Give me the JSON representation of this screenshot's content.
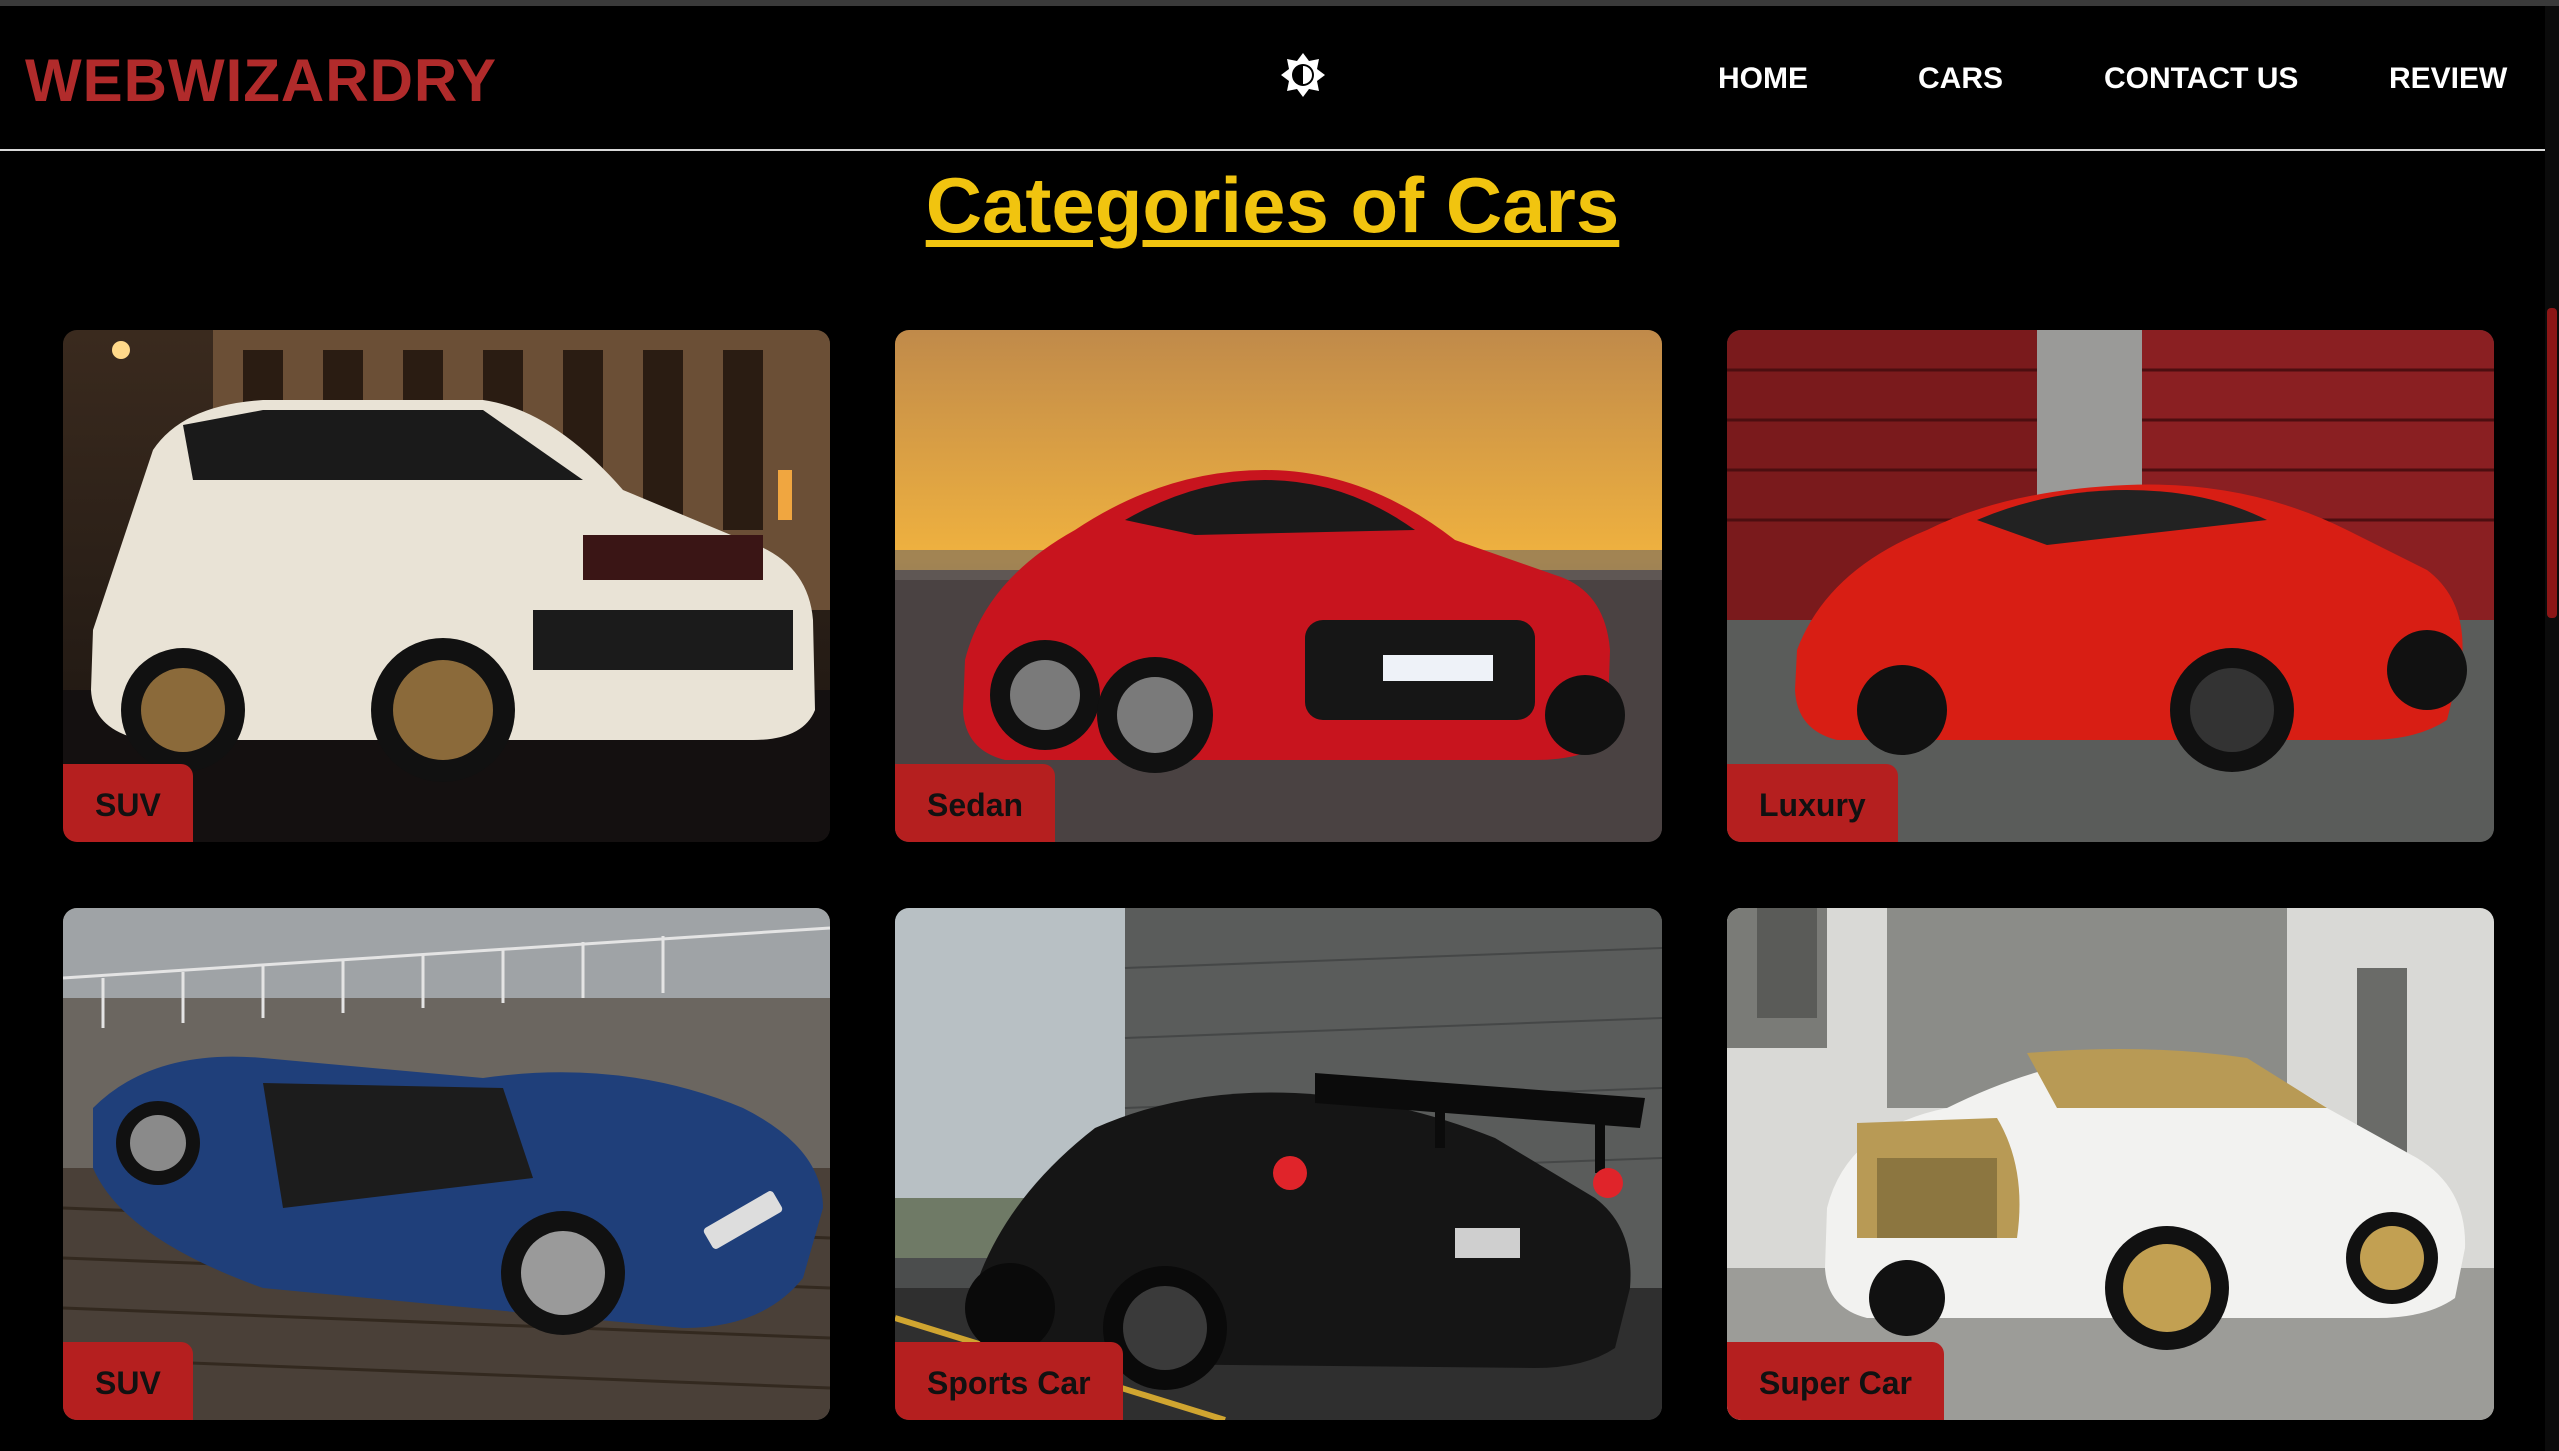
{
  "header": {
    "logo": "WEBWIZARDRY",
    "theme_toggle_icon": "brightness-icon",
    "nav": [
      "HOME",
      "CARS",
      "CONTACT US",
      "REVIEW"
    ]
  },
  "section": {
    "title": "Categories of Cars"
  },
  "cards": [
    {
      "label": "SUV",
      "car_color": "#e9e3d6",
      "scene": "city-street-night"
    },
    {
      "label": "Sedan",
      "car_color": "#c8141e",
      "scene": "sunset-shore"
    },
    {
      "label": "Luxury",
      "car_color": "#d81e14",
      "scene": "red-garage-door"
    },
    {
      "label": "SUV",
      "car_color": "#1f3f7a",
      "scene": "terrace-convertible"
    },
    {
      "label": "Sports Car",
      "car_color": "#151515",
      "scene": "concrete-road"
    },
    {
      "label": "Super Car",
      "car_color": "#f2f2f0",
      "scene": "stone-building"
    }
  ],
  "colors": {
    "brand": "#b12b2b",
    "title": "#f1c40f",
    "label_bg": "#b51f1f",
    "background": "#000000"
  }
}
